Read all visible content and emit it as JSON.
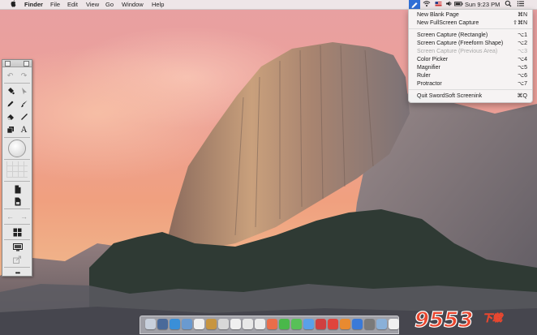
{
  "menubar": {
    "apple_icon": "apple-icon",
    "app_name": "Finder",
    "menus": [
      "File",
      "Edit",
      "View",
      "Go",
      "Window",
      "Help"
    ],
    "clock": "Sun 9:23 PM",
    "status_icons": [
      "screen-capture-icon",
      "wifi-icon",
      "flag-icon",
      "volume-icon",
      "battery-icon",
      "search-icon",
      "list-icon"
    ]
  },
  "dropdown": {
    "items": [
      {
        "label": "New Blank Page",
        "shortcut": "⌘N",
        "enabled": true
      },
      {
        "label": "New FullScreen Capture",
        "shortcut": "⇧⌘N",
        "enabled": true
      },
      {
        "label": "Screen Capture (Rectangle)",
        "shortcut": "⌥1",
        "enabled": true
      },
      {
        "label": "Screen Capture (Freeform Shape)",
        "shortcut": "⌥2",
        "enabled": true
      },
      {
        "label": "Screen Capture (Previous Area)",
        "shortcut": "⌥3",
        "enabled": false
      },
      {
        "label": "Color Picker",
        "shortcut": "⌥4",
        "enabled": true
      },
      {
        "label": "Magnifier",
        "shortcut": "⌥5",
        "enabled": true
      },
      {
        "label": "Ruler",
        "shortcut": "⌥6",
        "enabled": true
      },
      {
        "label": "Protractor",
        "shortcut": "⌥7",
        "enabled": true
      },
      {
        "label": "Quit SwordSoft Screenink",
        "shortcut": "⌘Q",
        "enabled": true
      }
    ]
  },
  "palette": {
    "tools": [
      "undo-icon",
      "redo-icon",
      "fill-icon",
      "cursor-icon",
      "pencil-icon",
      "brush-icon",
      "eraser-icon",
      "line-icon",
      "copy-icon",
      "text-icon",
      "color-circle-icon",
      "grid-icon",
      "new-page-icon",
      "save-icon",
      "back-icon",
      "forward-icon",
      "layout-icon",
      "screen-icon",
      "share-icon",
      "more-icon"
    ],
    "text_tool_glyph": "A",
    "more_glyph": "•••"
  },
  "dock": {
    "icon_colors": [
      "#c8d0dc",
      "#4a6a9a",
      "#3a8fd8",
      "#6a9ad0",
      "#f0f0f0",
      "#c79540",
      "#d8d8d8",
      "#f0f0f0",
      "#e8e8e8",
      "#ececec",
      "#ea6d4a",
      "#4ab84a",
      "#58c058",
      "#5aa0e8",
      "#d04040",
      "#e0443c",
      "#e88a30",
      "#3a7ad8",
      "#7a7a7a",
      "#8ab0d8",
      "#f0f0f0"
    ]
  },
  "watermark": {
    "text": "9553",
    "sub": "下载"
  },
  "colors": {
    "accent": "#2f6fd6"
  }
}
